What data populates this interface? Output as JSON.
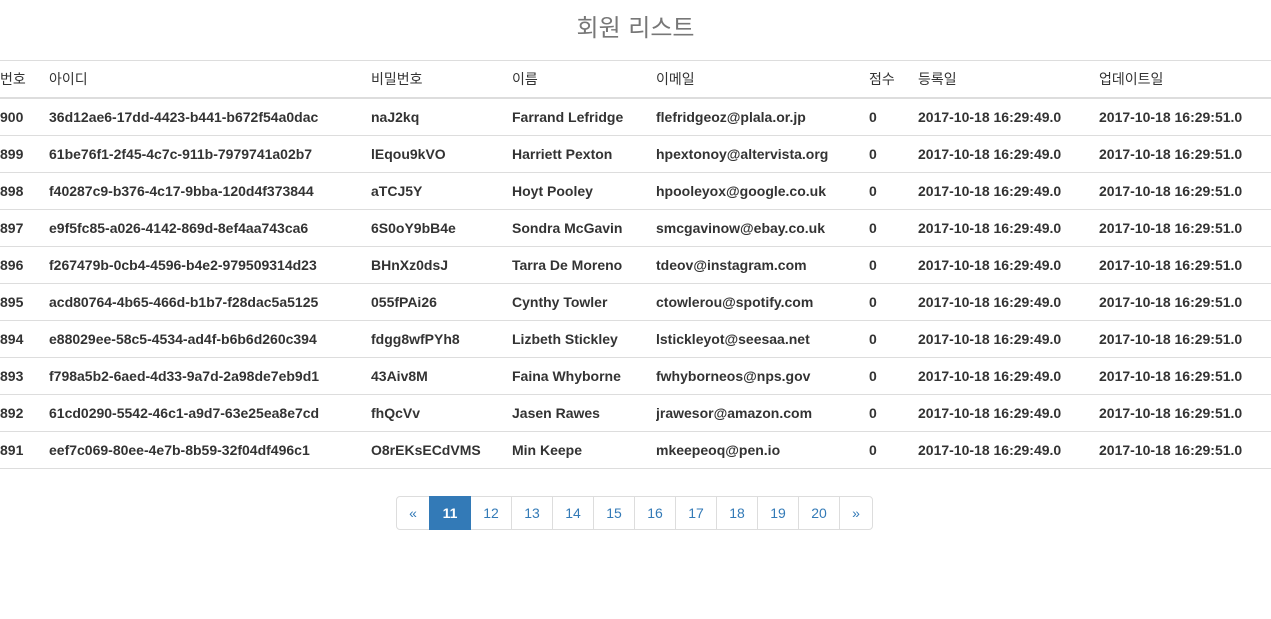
{
  "page": {
    "title": "회원 리스트"
  },
  "table": {
    "headers": [
      "번호",
      "아이디",
      "비밀번호",
      "이름",
      "이메일",
      "점수",
      "등록일",
      "업데이트일"
    ],
    "rows": [
      [
        "900",
        "36d12ae6-17dd-4423-b441-b672f54a0dac",
        "naJ2kq",
        "Farrand Lefridge",
        "flefridgeoz@plala.or.jp",
        "0",
        "2017-10-18 16:29:49.0",
        "2017-10-18 16:29:51.0"
      ],
      [
        "899",
        "61be76f1-2f45-4c7c-911b-7979741a02b7",
        "lEqou9kVO",
        "Harriett Pexton",
        "hpextonoy@altervista.org",
        "0",
        "2017-10-18 16:29:49.0",
        "2017-10-18 16:29:51.0"
      ],
      [
        "898",
        "f40287c9-b376-4c17-9bba-120d4f373844",
        "aTCJ5Y",
        "Hoyt Pooley",
        "hpooleyox@google.co.uk",
        "0",
        "2017-10-18 16:29:49.0",
        "2017-10-18 16:29:51.0"
      ],
      [
        "897",
        "e9f5fc85-a026-4142-869d-8ef4aa743ca6",
        "6S0oY9bB4e",
        "Sondra McGavin",
        "smcgavinow@ebay.co.uk",
        "0",
        "2017-10-18 16:29:49.0",
        "2017-10-18 16:29:51.0"
      ],
      [
        "896",
        "f267479b-0cb4-4596-b4e2-979509314d23",
        "BHnXz0dsJ",
        "Tarra De Moreno",
        "tdeov@instagram.com",
        "0",
        "2017-10-18 16:29:49.0",
        "2017-10-18 16:29:51.0"
      ],
      [
        "895",
        "acd80764-4b65-466d-b1b7-f28dac5a5125",
        "055fPAi26",
        "Cynthy Towler",
        "ctowlerou@spotify.com",
        "0",
        "2017-10-18 16:29:49.0",
        "2017-10-18 16:29:51.0"
      ],
      [
        "894",
        "e88029ee-58c5-4534-ad4f-b6b6d260c394",
        "fdgg8wfPYh8",
        "Lizbeth Stickley",
        "lstickleyot@seesaa.net",
        "0",
        "2017-10-18 16:29:49.0",
        "2017-10-18 16:29:51.0"
      ],
      [
        "893",
        "f798a5b2-6aed-4d33-9a7d-2a98de7eb9d1",
        "43Aiv8M",
        "Faina Whyborne",
        "fwhyborneos@nps.gov",
        "0",
        "2017-10-18 16:29:49.0",
        "2017-10-18 16:29:51.0"
      ],
      [
        "892",
        "61cd0290-5542-46c1-a9d7-63e25ea8e7cd",
        "fhQcVv",
        "Jasen Rawes",
        "jrawesor@amazon.com",
        "0",
        "2017-10-18 16:29:49.0",
        "2017-10-18 16:29:51.0"
      ],
      [
        "891",
        "eef7c069-80ee-4e7b-8b59-32f04df496c1",
        "O8rEKsECdVMS",
        "Min Keepe",
        "mkeepeoq@pen.io",
        "0",
        "2017-10-18 16:29:49.0",
        "2017-10-18 16:29:51.0"
      ]
    ]
  },
  "pagination": {
    "prev_label": "«",
    "next_label": "»",
    "pages": [
      "11",
      "12",
      "13",
      "14",
      "15",
      "16",
      "17",
      "18",
      "19",
      "20"
    ],
    "active_page": "11"
  },
  "colors": {
    "accent": "#337ab7",
    "border": "#dddddd",
    "title": "#777777",
    "text": "#333333"
  }
}
